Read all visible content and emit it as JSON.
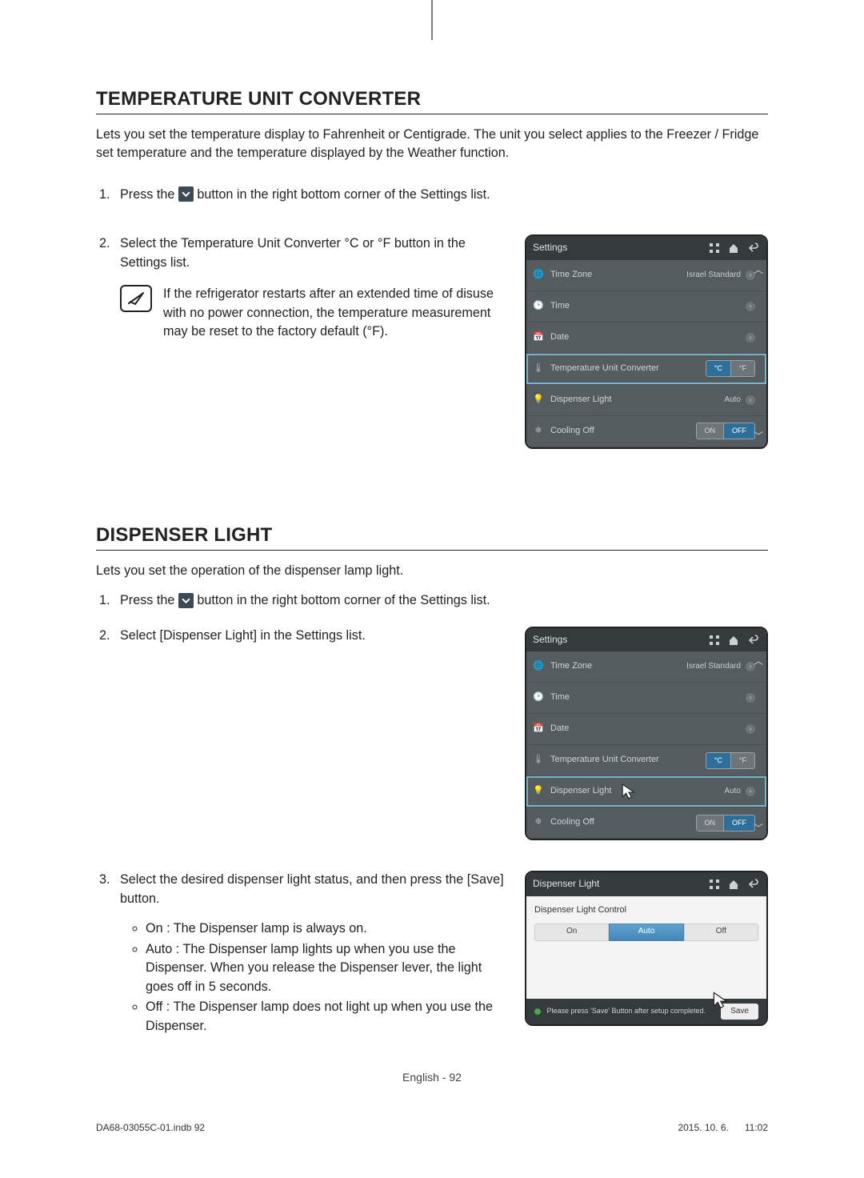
{
  "section1": {
    "title": "TEMPERATURE UNIT CONVERTER",
    "intro": "Lets you set the temperature display to Fahrenheit or Centigrade. The unit you select applies to the Freezer / Fridge set temperature and the temperature displayed by the Weather function.",
    "step1_a": "Press the",
    "step1_b": "button in the right bottom corner of the Settings list.",
    "step2": "Select the Temperature Unit Converter °C or °F button in the Settings list.",
    "note": "If the refrigerator restarts after an extended time of disuse with no power connection, the temperature measurement may be reset to the factory default (°F)."
  },
  "section2": {
    "title": "DISPENSER LIGHT",
    "intro": "Lets you set the operation of the dispenser lamp light.",
    "step1_a": "Press the",
    "step1_b": "button in the right bottom corner of the Settings list.",
    "step2": "Select [Dispenser Light] in the Settings list.",
    "step3": "Select the desired dispenser light status, and then press the [Save] button.",
    "bullets": {
      "b1": "On : The Dispenser lamp is always on.",
      "b2": "Auto : The Dispenser lamp lights up when you use the Dispenser. When you release the Dispenser lever, the light goes off in 5 seconds.",
      "b3": "Off : The Dispenser lamp does not light up when you use the Dispenser."
    }
  },
  "settings_panel": {
    "title": "Settings",
    "rows": {
      "tz_label": "Time Zone",
      "tz_value": "Israel Standard",
      "time": "Time",
      "date": "Date",
      "tuc": "Temperature Unit Converter",
      "tuc_c": "°C",
      "tuc_f": "°F",
      "dl": "Dispenser Light",
      "dl_value": "Auto",
      "co": "Cooling Off",
      "co_on": "ON",
      "co_off": "OFF"
    }
  },
  "dl_panel": {
    "title": "Dispenser Light",
    "subtitle": "Dispenser Light Control",
    "opt_on": "On",
    "opt_auto": "Auto",
    "opt_off": "Off",
    "footer_msg": "Please press 'Save' Button after setup completed.",
    "save": "Save"
  },
  "footer": {
    "center": "English - 92",
    "left": "DA68-03055C-01.indb   92",
    "right": "2015. 10. 6.      11:02"
  }
}
